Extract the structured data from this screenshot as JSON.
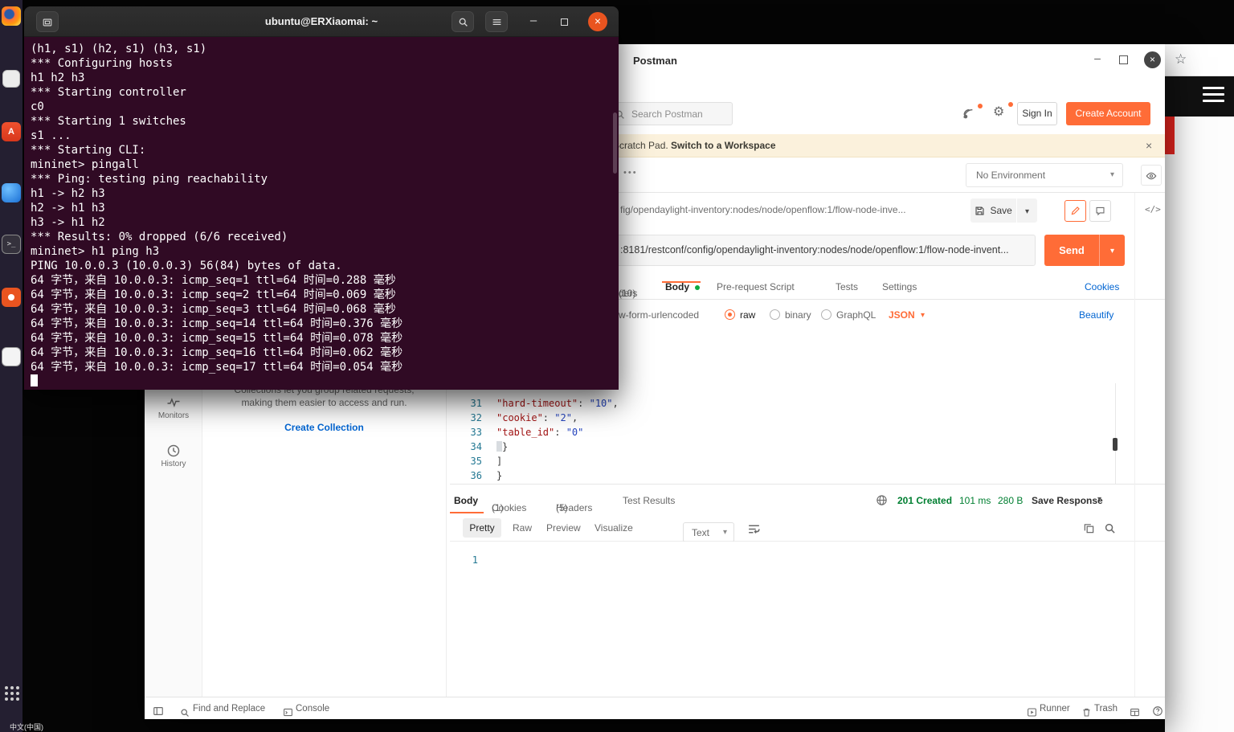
{
  "desktop": {
    "ime_label": "中文(中国)"
  },
  "icons": {
    "chevron_down": "▾",
    "close": "×",
    "gear": "⚙",
    "star": "☆",
    "overflow_dots": "•••",
    "code": "</>",
    "minimize": "–",
    "terminal_prompt": ">_"
  },
  "terminal": {
    "title": "ubuntu@ERXiaomai: ~",
    "lines": [
      "(h1, s1) (h2, s1) (h3, s1)",
      "*** Configuring hosts",
      "h1 h2 h3",
      "*** Starting controller",
      "c0",
      "*** Starting 1 switches",
      "s1 ...",
      "*** Starting CLI:",
      "mininet> pingall",
      "*** Ping: testing ping reachability",
      "h1 -> h2 h3",
      "h2 -> h1 h3",
      "h3 -> h1 h2",
      "*** Results: 0% dropped (6/6 received)",
      "mininet> h1 ping h3",
      "PING 10.0.0.3 (10.0.0.3) 56(84) bytes of data.",
      "64 字节，来自 10.0.0.3: icmp_seq=1 ttl=64 时间=0.288 毫秒",
      "64 字节，来自 10.0.0.3: icmp_seq=2 ttl=64 时间=0.069 毫秒",
      "64 字节，来自 10.0.0.3: icmp_seq=3 ttl=64 时间=0.068 毫秒",
      "64 字节，来自 10.0.0.3: icmp_seq=14 ttl=64 时间=0.376 毫秒",
      "64 字节，来自 10.0.0.3: icmp_seq=15 ttl=64 时间=0.078 毫秒",
      "64 字节，来自 10.0.0.3: icmp_seq=16 ttl=64 时间=0.062 毫秒",
      "64 字节，来自 10.0.0.3: icmp_seq=17 ttl=64 时间=0.054 毫秒"
    ]
  },
  "postman": {
    "title": "Postman",
    "header": {
      "search_placeholder": "Search Postman",
      "sign_in": "Sign In",
      "create_account": "Create Account"
    },
    "banner": {
      "text": "Scratch Pad.",
      "action": "Switch to a Workspace"
    },
    "env_bar": {
      "environment": "No Environment"
    },
    "request": {
      "name": "fig/opendaylight-inventory:nodes/node/openflow:1/flow-node-inve...",
      "url": ":8181/restconf/config/opendaylight-inventory:nodes/node/openflow:1/flow-node-invent...",
      "save": "Save",
      "send": "Send",
      "tabs": {
        "headers_partial": "ders ",
        "headers_count": "(10)",
        "body": "Body",
        "prerequest": "Pre-request Script",
        "tests": "Tests",
        "settings": "Settings",
        "cookies": "Cookies"
      },
      "body_types": {
        "urlencoded_partial": "w-form-urlencoded",
        "raw": "raw",
        "binary": "binary",
        "graphql": "GraphQL",
        "format": "JSON",
        "beautify": "Beautify"
      }
    },
    "editor": {
      "lines": [
        {
          "num": "31",
          "tokens": [
            {
              "c": "key",
              "v": "\"hard-timeout\""
            },
            {
              "c": "pun",
              "v": ": "
            },
            {
              "c": "str",
              "v": "\"10\""
            },
            {
              "c": "pun",
              "v": ","
            }
          ]
        },
        {
          "num": "32",
          "tokens": [
            {
              "c": "key",
              "v": "\"cookie\""
            },
            {
              "c": "pun",
              "v": ": "
            },
            {
              "c": "str",
              "v": "\"2\""
            },
            {
              "c": "pun",
              "v": ","
            }
          ]
        },
        {
          "num": "33",
          "tokens": [
            {
              "c": "key",
              "v": "\"table_id\""
            },
            {
              "c": "pun",
              "v": ": "
            },
            {
              "c": "str",
              "v": "\"0\""
            }
          ]
        },
        {
          "num": "34",
          "tokens": [
            {
              "c": "box",
              "v": " "
            },
            {
              "c": "pun",
              "v": "}"
            }
          ]
        },
        {
          "num": "35",
          "tokens": [
            {
              "c": "pun",
              "v": "]"
            }
          ]
        },
        {
          "num": "36",
          "tokens": [
            {
              "c": "pun",
              "v": "}"
            }
          ]
        }
      ]
    },
    "response": {
      "tabs": {
        "body": "Body",
        "cookies": "Cookies ",
        "cookies_count": "(1)",
        "headers": "Headers ",
        "headers_count": "(5)",
        "test_results": "Test Results"
      },
      "status": "201 Created",
      "time": "101 ms",
      "size": "280 B",
      "save_response": "Save Response",
      "views": [
        "Pretty",
        "Raw",
        "Preview",
        "Visualize"
      ],
      "language": "Text",
      "line_number": "1"
    },
    "sidebar": {
      "monitors": "Monitors",
      "history": "History",
      "empty_line1": "Collections let you group related requests,",
      "empty_line2": "making them easier to access and run.",
      "create_collection": "Create Collection"
    },
    "statusbar": {
      "find": "Find and Replace",
      "console": "Console",
      "runner": "Runner",
      "trash": "Trash"
    }
  },
  "colors": {
    "postman_orange": "#FF6C37",
    "link_blue": "#0265D2",
    "status_green": "#007F31",
    "terminal_bg": "#300A24",
    "ubuntu_orange": "#E95420"
  }
}
